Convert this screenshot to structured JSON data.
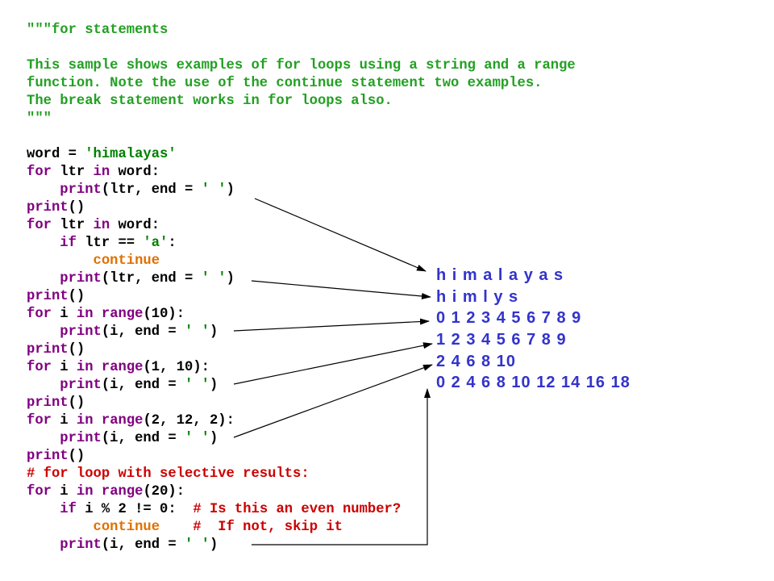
{
  "colors": {
    "docstring": "#22a022",
    "keyword": "#800080",
    "string": "#008000",
    "default": "#000000",
    "continue": "#e07000",
    "comment": "#cc0000",
    "output": "#3333cc",
    "arrow": "#000000"
  },
  "code_lines": [
    [
      {
        "t": "\"\"\"for statements",
        "c": "docstring"
      }
    ],
    [],
    [
      {
        "t": "This sample shows examples of for loops using a string and a range",
        "c": "docstring"
      }
    ],
    [
      {
        "t": "function. Note the use of the continue statement two examples.",
        "c": "docstring"
      }
    ],
    [
      {
        "t": "The break statement works in for loops also.",
        "c": "docstring"
      }
    ],
    [
      {
        "t": "\"\"\"",
        "c": "docstring"
      }
    ],
    [],
    [
      {
        "t": "word = ",
        "c": "default"
      },
      {
        "t": "'himalayas'",
        "c": "string"
      }
    ],
    [
      {
        "t": "for",
        "c": "keyword"
      },
      {
        "t": " ltr ",
        "c": "default"
      },
      {
        "t": "in",
        "c": "keyword"
      },
      {
        "t": " word:",
        "c": "default"
      }
    ],
    [
      {
        "t": "    ",
        "c": "default"
      },
      {
        "t": "print",
        "c": "keyword"
      },
      {
        "t": "(ltr, end = ",
        "c": "default"
      },
      {
        "t": "' '",
        "c": "string"
      },
      {
        "t": ")",
        "c": "default"
      }
    ],
    [
      {
        "t": "print",
        "c": "keyword"
      },
      {
        "t": "()",
        "c": "default"
      }
    ],
    [
      {
        "t": "for",
        "c": "keyword"
      },
      {
        "t": " ltr ",
        "c": "default"
      },
      {
        "t": "in",
        "c": "keyword"
      },
      {
        "t": " word:",
        "c": "default"
      }
    ],
    [
      {
        "t": "    ",
        "c": "default"
      },
      {
        "t": "if",
        "c": "keyword"
      },
      {
        "t": " ltr == ",
        "c": "default"
      },
      {
        "t": "'a'",
        "c": "string"
      },
      {
        "t": ":",
        "c": "default"
      }
    ],
    [
      {
        "t": "        ",
        "c": "default"
      },
      {
        "t": "continue",
        "c": "continue"
      }
    ],
    [
      {
        "t": "    ",
        "c": "default"
      },
      {
        "t": "print",
        "c": "keyword"
      },
      {
        "t": "(ltr, end = ",
        "c": "default"
      },
      {
        "t": "' '",
        "c": "string"
      },
      {
        "t": ")",
        "c": "default"
      }
    ],
    [
      {
        "t": "print",
        "c": "keyword"
      },
      {
        "t": "()",
        "c": "default"
      }
    ],
    [
      {
        "t": "for",
        "c": "keyword"
      },
      {
        "t": " i ",
        "c": "default"
      },
      {
        "t": "in",
        "c": "keyword"
      },
      {
        "t": " ",
        "c": "default"
      },
      {
        "t": "range",
        "c": "keyword"
      },
      {
        "t": "(10):",
        "c": "default"
      }
    ],
    [
      {
        "t": "    ",
        "c": "default"
      },
      {
        "t": "print",
        "c": "keyword"
      },
      {
        "t": "(i, end = ",
        "c": "default"
      },
      {
        "t": "' '",
        "c": "string"
      },
      {
        "t": ")",
        "c": "default"
      }
    ],
    [
      {
        "t": "print",
        "c": "keyword"
      },
      {
        "t": "()",
        "c": "default"
      }
    ],
    [
      {
        "t": "for",
        "c": "keyword"
      },
      {
        "t": " i ",
        "c": "default"
      },
      {
        "t": "in",
        "c": "keyword"
      },
      {
        "t": " ",
        "c": "default"
      },
      {
        "t": "range",
        "c": "keyword"
      },
      {
        "t": "(1, 10):",
        "c": "default"
      }
    ],
    [
      {
        "t": "    ",
        "c": "default"
      },
      {
        "t": "print",
        "c": "keyword"
      },
      {
        "t": "(i, end = ",
        "c": "default"
      },
      {
        "t": "' '",
        "c": "string"
      },
      {
        "t": ")",
        "c": "default"
      }
    ],
    [
      {
        "t": "print",
        "c": "keyword"
      },
      {
        "t": "()",
        "c": "default"
      }
    ],
    [
      {
        "t": "for",
        "c": "keyword"
      },
      {
        "t": " i ",
        "c": "default"
      },
      {
        "t": "in",
        "c": "keyword"
      },
      {
        "t": " ",
        "c": "default"
      },
      {
        "t": "range",
        "c": "keyword"
      },
      {
        "t": "(2, 12, 2):",
        "c": "default"
      }
    ],
    [
      {
        "t": "    ",
        "c": "default"
      },
      {
        "t": "print",
        "c": "keyword"
      },
      {
        "t": "(i, end = ",
        "c": "default"
      },
      {
        "t": "' '",
        "c": "string"
      },
      {
        "t": ")",
        "c": "default"
      }
    ],
    [
      {
        "t": "print",
        "c": "keyword"
      },
      {
        "t": "()",
        "c": "default"
      }
    ],
    [
      {
        "t": "# for loop with selective results:",
        "c": "comment"
      }
    ],
    [
      {
        "t": "for",
        "c": "keyword"
      },
      {
        "t": " i ",
        "c": "default"
      },
      {
        "t": "in",
        "c": "keyword"
      },
      {
        "t": " ",
        "c": "default"
      },
      {
        "t": "range",
        "c": "keyword"
      },
      {
        "t": "(20):",
        "c": "default"
      }
    ],
    [
      {
        "t": "    ",
        "c": "default"
      },
      {
        "t": "if",
        "c": "keyword"
      },
      {
        "t": " i % 2 != 0:  ",
        "c": "default"
      },
      {
        "t": "# Is this an even number?",
        "c": "comment"
      }
    ],
    [
      {
        "t": "        ",
        "c": "default"
      },
      {
        "t": "continue",
        "c": "continue"
      },
      {
        "t": "    ",
        "c": "default"
      },
      {
        "t": "#  If not, skip it",
        "c": "comment"
      }
    ],
    [
      {
        "t": "    ",
        "c": "default"
      },
      {
        "t": "print",
        "c": "keyword"
      },
      {
        "t": "(i, end = ",
        "c": "default"
      },
      {
        "t": "' '",
        "c": "string"
      },
      {
        "t": ")",
        "c": "default"
      }
    ]
  ],
  "output_lines": [
    "h i m a l a y a s",
    "h i m l y s",
    "0 1 2 3 4 5 6 7 8 9",
    "1 2 3 4 5 6 7 8 9",
    "2 4 6 8 10",
    "0 2 4 6 8 10 12 14 16 18"
  ]
}
